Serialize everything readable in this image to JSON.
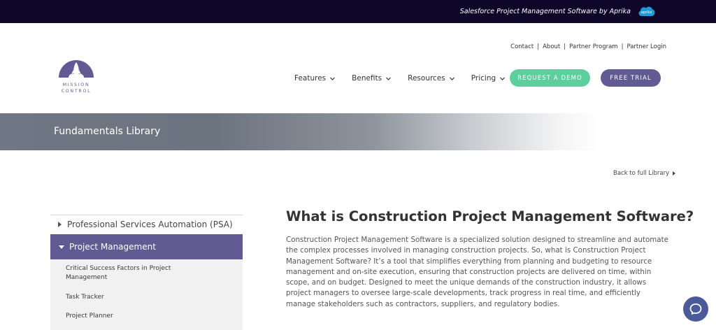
{
  "topbar": {
    "text": "Salesforce Project Management Software by Aprika",
    "badge_label": "aprika"
  },
  "top_links": [
    "Contact",
    "About",
    "Partner Program",
    "Partner Login"
  ],
  "logo": {
    "line1": "MISSION",
    "line2": "CONTROL"
  },
  "nav": {
    "items": [
      "Features",
      "Benefits",
      "Resources",
      "Pricing"
    ],
    "demo_button": "REQUEST A DEMO",
    "trial_button": "FREE TRIAL"
  },
  "banner": {
    "title": "Fundamentals Library"
  },
  "back_link": "Back to full Library",
  "sidebar": {
    "psa": "Professional Services Automation (PSA)",
    "project_management": "Project Management",
    "sub_items": [
      "Critical Success Factors in Project Management",
      "Task Tracker",
      "Project Planner"
    ]
  },
  "content": {
    "title": "What is Construction Project Management Software?",
    "body": "Construction Project Management Software is a specialized solution designed to streamline and automate the complex processes involved in managing construction projects. So, what is Construction Project Management Software? It’s a tool that simplifies everything from planning and budgeting to resource management and on-site execution, ensuring that construction projects are delivered on time, within scope, and on budget. Designed to meet the unique demands of the construction industry, it allows project managers to oversee large-scale developments, track progress in real time, and efficiently manage stakeholders such as contractors, suppliers, and regulatory bodies."
  },
  "colors": {
    "topbar": "#0d0628",
    "accent_purple": "#625a93",
    "accent_green": "#5ccf9d",
    "chat": "#4d5a99"
  },
  "icons": {
    "aprika": "cloud-logo",
    "logo": "rocket-logo",
    "nav_chevron": "chevron-down-icon",
    "chat": "chat-bubble-icon"
  }
}
